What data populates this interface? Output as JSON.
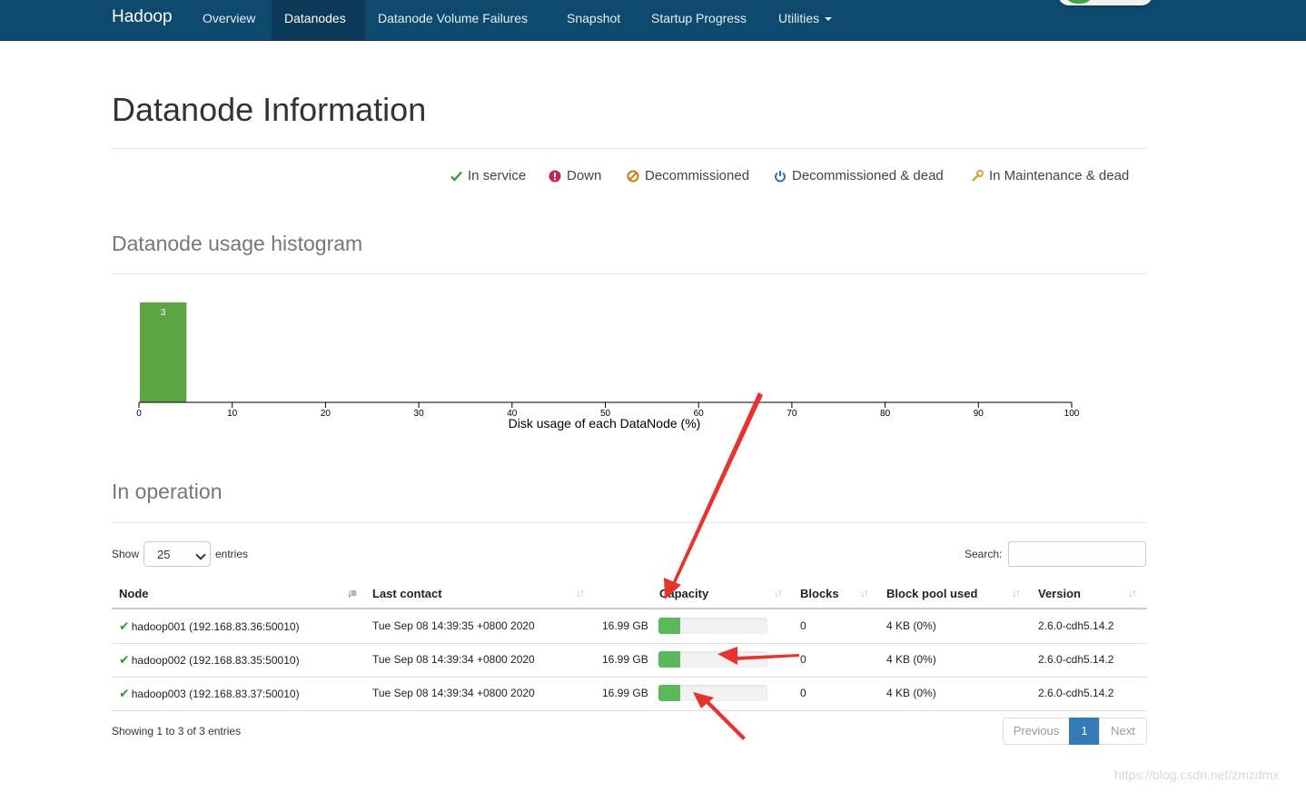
{
  "nav": {
    "brand": "Hadoop",
    "items": [
      {
        "label": "Overview"
      },
      {
        "label": "Datanodes",
        "active": true
      },
      {
        "label": "Datanode Volume Failures"
      },
      {
        "label": "Snapshot"
      },
      {
        "label": "Startup Progress"
      },
      {
        "label": "Utilities",
        "dropdown": true
      }
    ]
  },
  "page_title": "Datanode Information",
  "legend": [
    {
      "label": "In service",
      "icon": "check-icon",
      "color": "#3a9a3a"
    },
    {
      "label": "Down",
      "icon": "exclamation-circle-icon",
      "color": "#c7254e"
    },
    {
      "label": "Decommissioned",
      "icon": "ban-icon",
      "color": "#c57a16"
    },
    {
      "label": "Decommissioned & dead",
      "icon": "power-icon",
      "color": "#2a6fb0"
    },
    {
      "label": "In Maintenance & dead",
      "icon": "wrench-icon",
      "color": "#e0a030"
    }
  ],
  "histogram_title": "Datanode usage histogram",
  "chart_data": {
    "type": "bar",
    "xlabel": "Disk usage of each DataNode (%)",
    "xlim": [
      0,
      100
    ],
    "xticks": [
      "0",
      "10",
      "20",
      "30",
      "40",
      "50",
      "60",
      "70",
      "80",
      "90",
      "100"
    ],
    "bins": [
      {
        "x0": 0,
        "x1": 5,
        "count": 3,
        "label": "3"
      }
    ],
    "bar_color": "#5ba543"
  },
  "operation_title": "In operation",
  "controls": {
    "show_label": "Show",
    "page_size": "25",
    "entries_label": "entries",
    "search_label": "Search:"
  },
  "table": {
    "columns": [
      "Node",
      "Last contact",
      "Capacity",
      "Blocks",
      "Block pool used",
      "Version"
    ],
    "rows": [
      {
        "node": "hadoop001 (192.168.83.36:50010)",
        "last_contact": "Tue Sep 08 14:39:35 +0800 2020",
        "capacity": "16.99 GB",
        "usage_fraction": 0.2,
        "blocks": "0",
        "pool_used": "4 KB (0%)",
        "version": "2.6.0-cdh5.14.2"
      },
      {
        "node": "hadoop002 (192.168.83.35:50010)",
        "last_contact": "Tue Sep 08 14:39:34 +0800 2020",
        "capacity": "16.99 GB",
        "usage_fraction": 0.2,
        "blocks": "0",
        "pool_used": "4 KB (0%)",
        "version": "2.6.0-cdh5.14.2"
      },
      {
        "node": "hadoop003 (192.168.83.37:50010)",
        "last_contact": "Tue Sep 08 14:39:34 +0800 2020",
        "capacity": "16.99 GB",
        "usage_fraction": 0.2,
        "blocks": "0",
        "pool_used": "4 KB (0%)",
        "version": "2.6.0-cdh5.14.2"
      }
    ]
  },
  "info": "Showing 1 to 3 of 3 entries",
  "pagination": {
    "previous": "Previous",
    "current": "1",
    "next": "Next"
  },
  "watermark": "https://blog.csdn.net/zmzdmx"
}
